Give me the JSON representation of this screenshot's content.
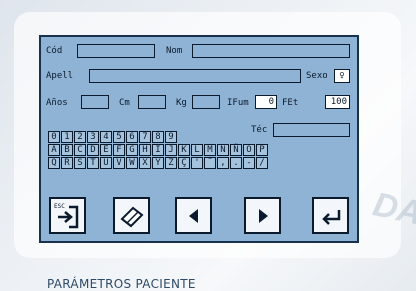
{
  "form": {
    "cod_label": "Cód",
    "nom_label": "Nom",
    "apell_label": "Apell",
    "sexo_label": "Sexo",
    "sexo_value": "♀",
    "anos_label": "Años",
    "cm_label": "Cm",
    "kg_label": "Kg",
    "ifum_label": "IFum",
    "ifum_value": "0",
    "fet_label": "FEt",
    "fet_value": "100",
    "tec_label": "Téc"
  },
  "keyboard": {
    "row1": [
      "0",
      "1",
      "2",
      "3",
      "4",
      "5",
      "6",
      "7",
      "8",
      "9"
    ],
    "row2": [
      "A",
      "B",
      "C",
      "D",
      "E",
      "F",
      "G",
      "H",
      "I",
      "J",
      "K",
      "L",
      "M",
      "N",
      "Ñ",
      "O",
      "P"
    ],
    "row3": [
      "Q",
      "R",
      "S",
      "T",
      "U",
      "V",
      "W",
      "X",
      "Y",
      "Z",
      "Ç",
      "'",
      "¨",
      ",",
      ".",
      "-",
      "/"
    ]
  },
  "buttons": {
    "esc_label": "ESC"
  },
  "caption": "PARÁMETROS PACIENTE",
  "colors": {
    "panel": "#8fb3d4",
    "border": "#0b1a2c",
    "caption": "#2f4a66"
  }
}
